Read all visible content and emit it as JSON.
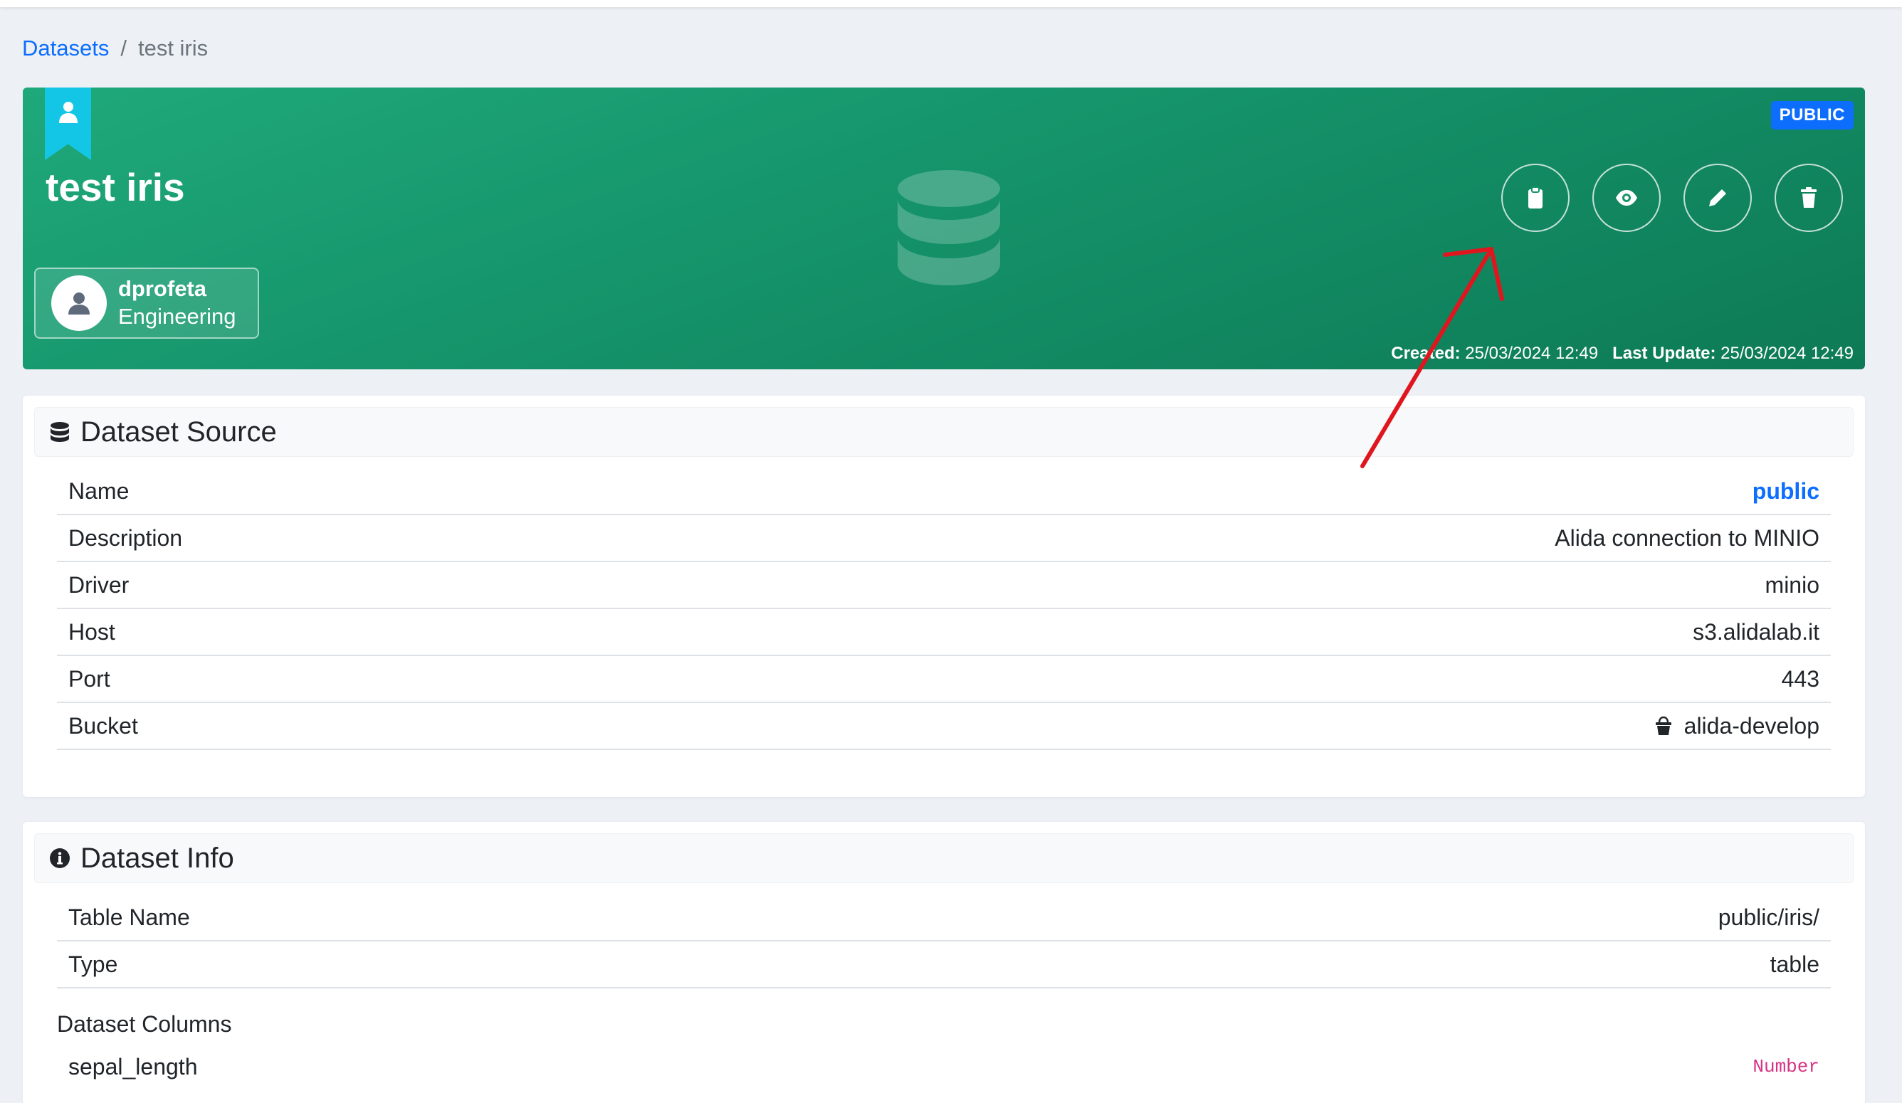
{
  "breadcrumb": {
    "root": "Datasets",
    "separator": "/",
    "current": "test iris"
  },
  "banner": {
    "title": "test iris",
    "visibility_badge": "PUBLIC",
    "owner": {
      "name": "dprofeta",
      "team": "Engineering"
    },
    "created_label": "Created:",
    "created_value": "25/03/2024 12:49",
    "updated_label": "Last Update:",
    "updated_value": "25/03/2024 12:49",
    "actions": [
      "clipboard-icon",
      "eye-icon",
      "pencil-icon",
      "trash-icon"
    ],
    "colors": {
      "gradient_start": "#1fa97a",
      "gradient_end": "#0d7a55",
      "ribbon": "#14c6e6",
      "badge": "#0d6efd"
    }
  },
  "source": {
    "title": "Dataset Source",
    "rows": [
      {
        "key": "Name",
        "value": "public"
      },
      {
        "key": "Description",
        "value": "Alida connection to MINIO"
      },
      {
        "key": "Driver",
        "value": "minio"
      },
      {
        "key": "Host",
        "value": "s3.alidalab.it"
      },
      {
        "key": "Port",
        "value": "443"
      },
      {
        "key": "Bucket",
        "value": "alida-develop"
      }
    ]
  },
  "info": {
    "title": "Dataset Info",
    "rows": [
      {
        "key": "Table Name",
        "value": "public/iris/"
      },
      {
        "key": "Type",
        "value": "table"
      }
    ],
    "columns_heading": "Dataset Columns",
    "columns": [
      {
        "name": "sepal_length",
        "type": "Number"
      }
    ]
  },
  "annotation": {
    "color": "#e0161e",
    "shape": "red-arrow"
  }
}
